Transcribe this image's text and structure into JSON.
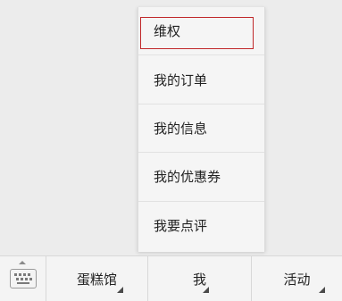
{
  "popup_menu": {
    "items": [
      {
        "label": "维权",
        "highlighted": true
      },
      {
        "label": "我的订单"
      },
      {
        "label": "我的信息"
      },
      {
        "label": "我的优惠券"
      },
      {
        "label": "我要点评"
      }
    ]
  },
  "bottom_bar": {
    "keyboard_icon": "keyboard-icon",
    "tabs": [
      {
        "label": "蛋糕馆",
        "icon": "submenu-corner-icon"
      },
      {
        "label": "我",
        "icon": "submenu-corner-icon"
      },
      {
        "label": "活动",
        "icon": "submenu-corner-icon"
      }
    ]
  },
  "colors": {
    "background": "#ececec",
    "highlight_border": "#c0282a"
  }
}
